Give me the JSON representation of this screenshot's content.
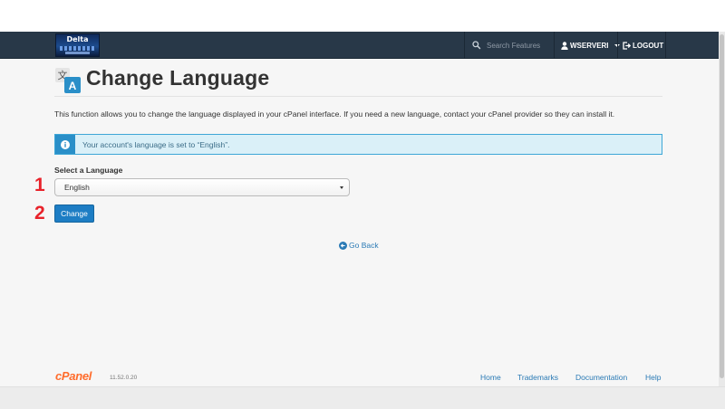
{
  "header": {
    "logo_label": "Delta",
    "search_placeholder": "Search Features",
    "user_label": "WSERVERI",
    "logout_label": "LOGOUT"
  },
  "page": {
    "title": "Change Language",
    "description": "This function allows you to change the language displayed in your cPanel interface. If you need a new language, contact your cPanel provider so they can install it.",
    "alert": "Your account's language is set to “English”.",
    "select_label": "Select a Language",
    "select_value": "English",
    "change_button": "Change",
    "go_back": "Go Back"
  },
  "annotations": {
    "step1": "1",
    "step2": "2"
  },
  "footer": {
    "brand": "cPanel",
    "version": "11.52.0.20",
    "links": [
      "Home",
      "Trademarks",
      "Documentation",
      "Help"
    ]
  },
  "colors": {
    "navbar": "#283848",
    "accent": "#1d7dc4",
    "alert_bg": "#daf0f8",
    "alert_border": "#3ea7d7",
    "annotation_red": "#e8222a",
    "brand_orange": "#ff6c2c"
  },
  "icons": [
    "search-icon",
    "user-icon",
    "logout-icon",
    "language-icon",
    "info-icon",
    "arrow-left-circle-icon"
  ]
}
